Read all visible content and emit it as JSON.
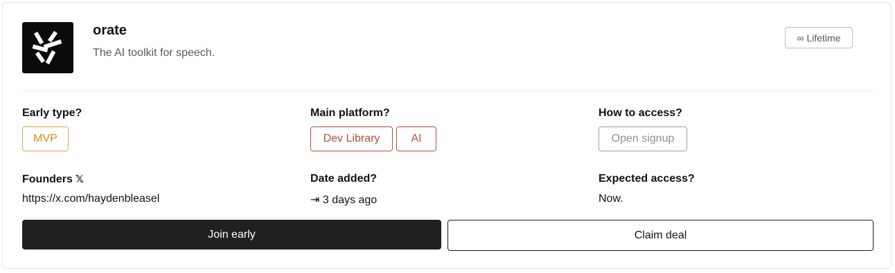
{
  "product": {
    "name": "orate",
    "tagline": "The AI toolkit for speech.",
    "logo_icon": "orate-logo-icon",
    "badge": {
      "icon": "∞",
      "label": "Lifetime"
    }
  },
  "fields": {
    "early_type": {
      "label": "Early type?",
      "tags": [
        "MVP"
      ]
    },
    "main_platform": {
      "label": "Main platform?",
      "tags": [
        "Dev Library",
        "AI"
      ]
    },
    "how_to_access": {
      "label": "How to access?",
      "tags": [
        "Open signup"
      ]
    },
    "founders": {
      "label": "Founders",
      "icon": "𝕏",
      "value": "https://x.com/haydenbleasel"
    },
    "date_added": {
      "label": "Date added?",
      "icon": "⇥",
      "value": "3 days ago"
    },
    "expected_access": {
      "label": "Expected access?",
      "value": "Now."
    }
  },
  "actions": {
    "join_label": "Join early",
    "claim_label": "Claim deal"
  },
  "colors": {
    "mvp": "#d98b1b",
    "platform": "#b4503a",
    "access": "#8a9396",
    "primary_button": "#202020"
  }
}
